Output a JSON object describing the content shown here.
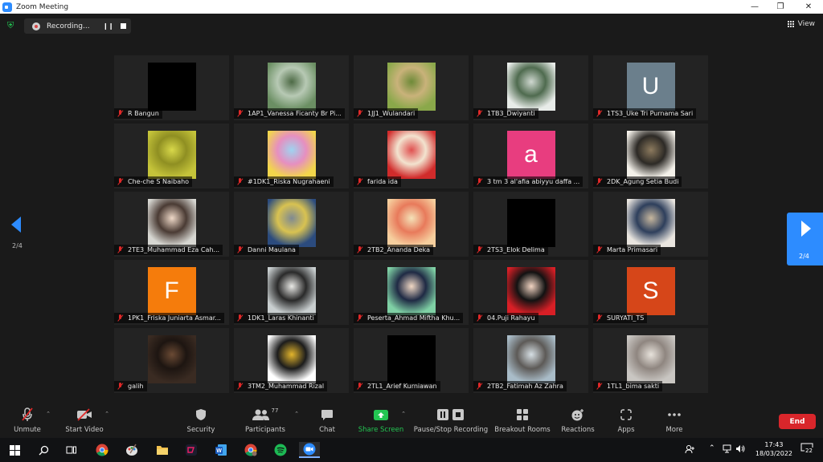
{
  "window": {
    "title": "Zoom Meeting"
  },
  "recording": {
    "label": "Recording..."
  },
  "view": {
    "label": "View"
  },
  "pager": {
    "left": "2/4",
    "right": "2/4"
  },
  "participants": [
    {
      "name": "R Bangun",
      "kind": "black"
    },
    {
      "name": "1AP1_Vanessa Ficanty Br Pi...",
      "kind": "photo",
      "colors": [
        "#6b8f63",
        "#b7c9b4",
        "#4d6a45"
      ]
    },
    {
      "name": "1JJ1_Wulandari",
      "kind": "photo",
      "colors": [
        "#8aa84a",
        "#c9b27a",
        "#6e8a38"
      ]
    },
    {
      "name": "1TB3_Dwiyanti",
      "kind": "photo",
      "colors": [
        "#e8ece9",
        "#4f6b4f",
        "#cfd8d0"
      ]
    },
    {
      "name": "1TS3_Uke Tri Purnama Sari",
      "kind": "initial",
      "initial": "U",
      "color": "#6b7f8c"
    },
    {
      "name": "Che-che S Naibaho",
      "kind": "photo",
      "colors": [
        "#c5c43a",
        "#8f8f22",
        "#d8d84a"
      ]
    },
    {
      "name": "#1DK1_Riska Nugrahaeni",
      "kind": "photo",
      "colors": [
        "#f2d64b",
        "#e68fc0",
        "#9fd3f0"
      ]
    },
    {
      "name": "farida ida",
      "kind": "photo",
      "colors": [
        "#d12b2b",
        "#f2e3cf",
        "#e05050"
      ]
    },
    {
      "name": "3 tm 3 al'afia abiyyu daffa ...",
      "kind": "initial",
      "initial": "a",
      "color": "#e83d7f"
    },
    {
      "name": "2DK_Agung Setia Budi",
      "kind": "photo",
      "colors": [
        "#f4f1ea",
        "#2d2a26",
        "#8c7a5e"
      ]
    },
    {
      "name": "2TE3_Muhammad Eza Cah...",
      "kind": "photo",
      "colors": [
        "#d7d7d2",
        "#4a3b34",
        "#efd9c8"
      ]
    },
    {
      "name": "Danni Maulana",
      "kind": "photo",
      "colors": [
        "#2b4b7e",
        "#d8c251",
        "#7f8a92"
      ]
    },
    {
      "name": "2TB2_Ananda Deka",
      "kind": "photo",
      "colors": [
        "#f6cf9e",
        "#e87a5b",
        "#f4e2b8"
      ]
    },
    {
      "name": "2TS3_Elok Delima",
      "kind": "black"
    },
    {
      "name": "Marta Primasari",
      "kind": "photo",
      "colors": [
        "#e9e5df",
        "#2e3f5c",
        "#c7b79e"
      ]
    },
    {
      "name": "1PK1_Friska Juniarta Asmar...",
      "kind": "initial",
      "initial": "F",
      "color": "#f57c0c"
    },
    {
      "name": "1DK1_Laras Khinanti",
      "kind": "photo",
      "colors": [
        "#c9cfd0",
        "#2a2a2a",
        "#e9e9e6"
      ]
    },
    {
      "name": "Peserta_Ahmad Miftha Khu...",
      "kind": "photo",
      "colors": [
        "#7fd1a5",
        "#1f2a44",
        "#f1d8c4"
      ]
    },
    {
      "name": "04.Puji Rahayu",
      "kind": "photo",
      "colors": [
        "#d81f26",
        "#121212",
        "#f2d4c2"
      ]
    },
    {
      "name": "SURYATI_TS",
      "kind": "initial",
      "initial": "S",
      "color": "#d64619"
    },
    {
      "name": "galih",
      "kind": "photo",
      "colors": [
        "#3a2b22",
        "#1d1511",
        "#6a4a34"
      ]
    },
    {
      "name": "3TM2_Muhammad Rizal",
      "kind": "photo",
      "colors": [
        "#ffffff",
        "#1c1c1c",
        "#e3b52c"
      ]
    },
    {
      "name": "2TL1_Arief Kurniawan",
      "kind": "black"
    },
    {
      "name": "2TB2_Fatimah Az Zahra",
      "kind": "photo",
      "colors": [
        "#a9bcc8",
        "#5d5a57",
        "#d6dfe4"
      ]
    },
    {
      "name": "1TL1_bima sakti",
      "kind": "photo",
      "colors": [
        "#c9c6c2",
        "#8f8680",
        "#e7e2db"
      ]
    }
  ],
  "toolbar": {
    "unmute": "Unmute",
    "start_video": "Start Video",
    "security": "Security",
    "participants": "Participants",
    "participants_count": "77",
    "chat": "Chat",
    "share_screen": "Share Screen",
    "recording": "Pause/Stop Recording",
    "breakout": "Breakout Rooms",
    "reactions": "Reactions",
    "apps": "Apps",
    "more": "More",
    "end": "End"
  },
  "taskbar": {
    "time": "17:43",
    "date": "18/03/2022",
    "notifications": "22"
  },
  "colors": {
    "accent": "#2d8cff",
    "end": "#d9262b",
    "share": "#23c552"
  }
}
